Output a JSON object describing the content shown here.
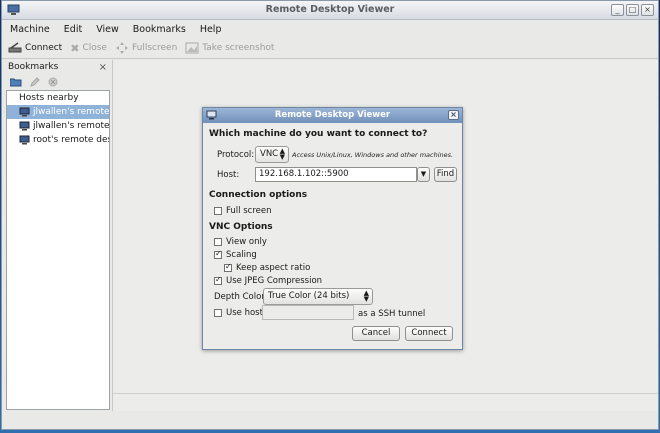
{
  "window": {
    "title": "Remote Desktop Viewer",
    "controls": [
      "_",
      "□",
      "×"
    ]
  },
  "menu": [
    "Machine",
    "Edit",
    "View",
    "Bookmarks",
    "Help"
  ],
  "toolbar": {
    "connect": "Connect",
    "close": "Close",
    "fullscreen": "Fullscreen",
    "screenshot": "Take screenshot"
  },
  "sidebar": {
    "title": "Bookmarks",
    "close_glyph": "×",
    "group": "Hosts nearby",
    "items": [
      "jlwallen's remote...",
      "jlwallen's remote...",
      "root's remote des..."
    ]
  },
  "dialog": {
    "title": "Remote Desktop Viewer",
    "close_glyph": "×",
    "heading": "Which machine do you want to connect to?",
    "protocol_label": "Protocol:",
    "protocol_value": "VNC",
    "protocol_hint": "Access Unix/Linux, Windows and other machines.",
    "host_label": "Host:",
    "host_value": "192.168.1.102::5900",
    "find_button": "Find",
    "connection_options_heading": "Connection options",
    "full_screen": {
      "label": "Full screen",
      "checked": false
    },
    "vnc_options_heading": "VNC Options",
    "view_only": {
      "label": "View only",
      "checked": false
    },
    "scaling": {
      "label": "Scaling",
      "checked": true
    },
    "keep_aspect": {
      "label": "Keep aspect ratio",
      "checked": true
    },
    "jpeg": {
      "label": "Use JPEG Compression",
      "checked": true
    },
    "depth_label": "Depth Color:",
    "depth_value": "True Color (24 bits)",
    "use_host": {
      "label": "Use host",
      "checked": false
    },
    "use_host_value": "",
    "ssh_tunnel_label": "as a SSH tunnel",
    "cancel_button": "Cancel",
    "connect_button": "Connect"
  }
}
